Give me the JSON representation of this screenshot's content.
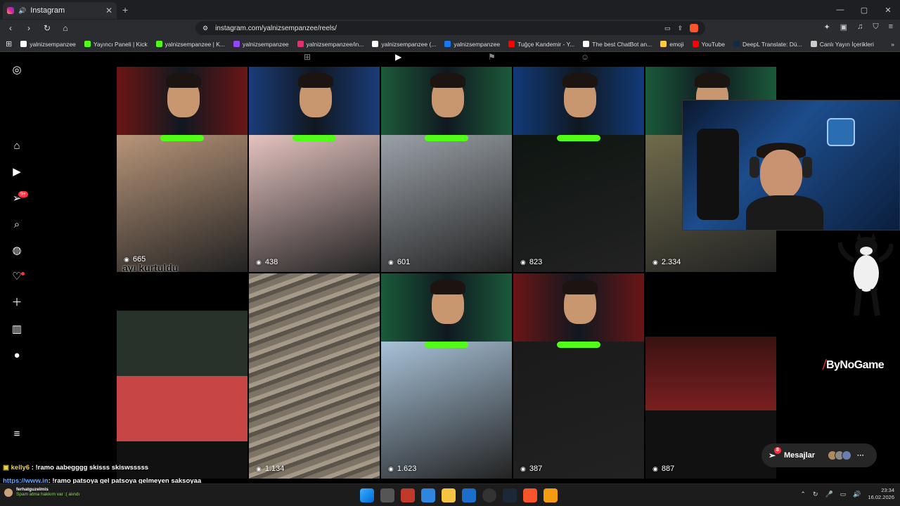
{
  "browser": {
    "tab_title": "Instagram",
    "new_tab": "+",
    "address": "instagram.com/yalnizsempanzee/reels/",
    "window_controls": [
      "—",
      "▢",
      "✕"
    ]
  },
  "bookmarks": [
    {
      "label": "yalnizsempanzee",
      "color": "#ffffff"
    },
    {
      "label": "Yayıncı Paneli | Kick",
      "color": "#53fc18"
    },
    {
      "label": "yalnizsempanzee | K...",
      "color": "#53fc18"
    },
    {
      "label": "yalnizsempanzee",
      "color": "#9146ff"
    },
    {
      "label": "yalnizsempanzee/in...",
      "color": "#e1306c"
    },
    {
      "label": "yalnizsempanzee (...",
      "color": "#ffffff"
    },
    {
      "label": "yalnizsempanzee",
      "color": "#1877f2"
    },
    {
      "label": "Tuğçe Kandemir - Y...",
      "color": "#ff0000"
    },
    {
      "label": "The best ChatBot an...",
      "color": "#ffffff"
    },
    {
      "label": "emoji",
      "color": "#ffcc33"
    },
    {
      "label": "YouTube",
      "color": "#ff0000"
    },
    {
      "label": "DeepL Translate: Dü...",
      "color": "#0f2b46"
    },
    {
      "label": "Canlı Yayın İçerikleri",
      "color": "#cccccc"
    }
  ],
  "sidebar": {
    "notification_badge": "9+",
    "items": [
      "instagram-logo-icon",
      "home-icon",
      "reels-icon",
      "messages-icon",
      "search-icon",
      "explore-icon",
      "heart-icon",
      "create-icon",
      "dashboard-icon",
      "profile-icon",
      "menu-icon"
    ]
  },
  "reels": [
    {
      "views": "665",
      "caption": "ayı kurtuldu"
    },
    {
      "views": "438",
      "caption": ""
    },
    {
      "views": "601",
      "caption": ""
    },
    {
      "views": "823",
      "caption": ""
    },
    {
      "views": "2.334",
      "caption": ""
    },
    {
      "views": "",
      "caption": ""
    },
    {
      "views": "1.134",
      "caption": ""
    },
    {
      "views": "1.623",
      "caption": ""
    },
    {
      "views": "387",
      "caption": ""
    },
    {
      "views": "887",
      "caption": ""
    }
  ],
  "overlay": {
    "brand": "ByNoGame"
  },
  "messages_bar": {
    "label": "Mesajlar",
    "badge": "8"
  },
  "chat": [
    {
      "user": "kelly6",
      "text": ": !ramo aabegggg skisss skiswsssss"
    },
    {
      "user": "https://www.in",
      "text": ": !ramo patsoya gel patsoya gelmeyen saksoyaa"
    }
  ],
  "taskbar": {
    "notification_user": "ferhatguzelmis",
    "notification_text": "Spam atma hakkım var :( alındı",
    "time": "23:34",
    "date": "16.02.2026"
  }
}
